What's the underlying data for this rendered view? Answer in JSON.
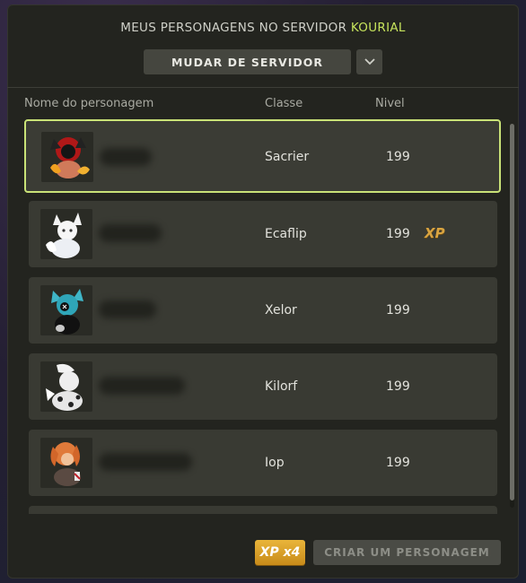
{
  "header": {
    "title_prefix": "MEUS PERSONAGENS NO SERVIDOR",
    "server_name": "KOURIAL",
    "switch_server_label": "MUDAR DE SERVIDOR"
  },
  "columns": {
    "name": "Nome do personagem",
    "class": "Classe",
    "level": "Nivel"
  },
  "characters": [
    {
      "class": "Sacrier",
      "level": "199",
      "selected": true,
      "xp_badge": ""
    },
    {
      "class": "Ecaflip",
      "level": "199",
      "selected": false,
      "xp_badge": "XP"
    },
    {
      "class": "Xelor",
      "level": "199",
      "selected": false,
      "xp_badge": ""
    },
    {
      "class": "Kilorf",
      "level": "199",
      "selected": false,
      "xp_badge": ""
    },
    {
      "class": "Iop",
      "level": "199",
      "selected": false,
      "xp_badge": ""
    }
  ],
  "footer": {
    "xp_multiplier_label": "XP x4",
    "create_label": "CRIAR UM PERSONAGEM"
  },
  "colors": {
    "accent": "#c6e35c",
    "selected_border": "#c9e277",
    "xp_gold": "#d9a441"
  }
}
